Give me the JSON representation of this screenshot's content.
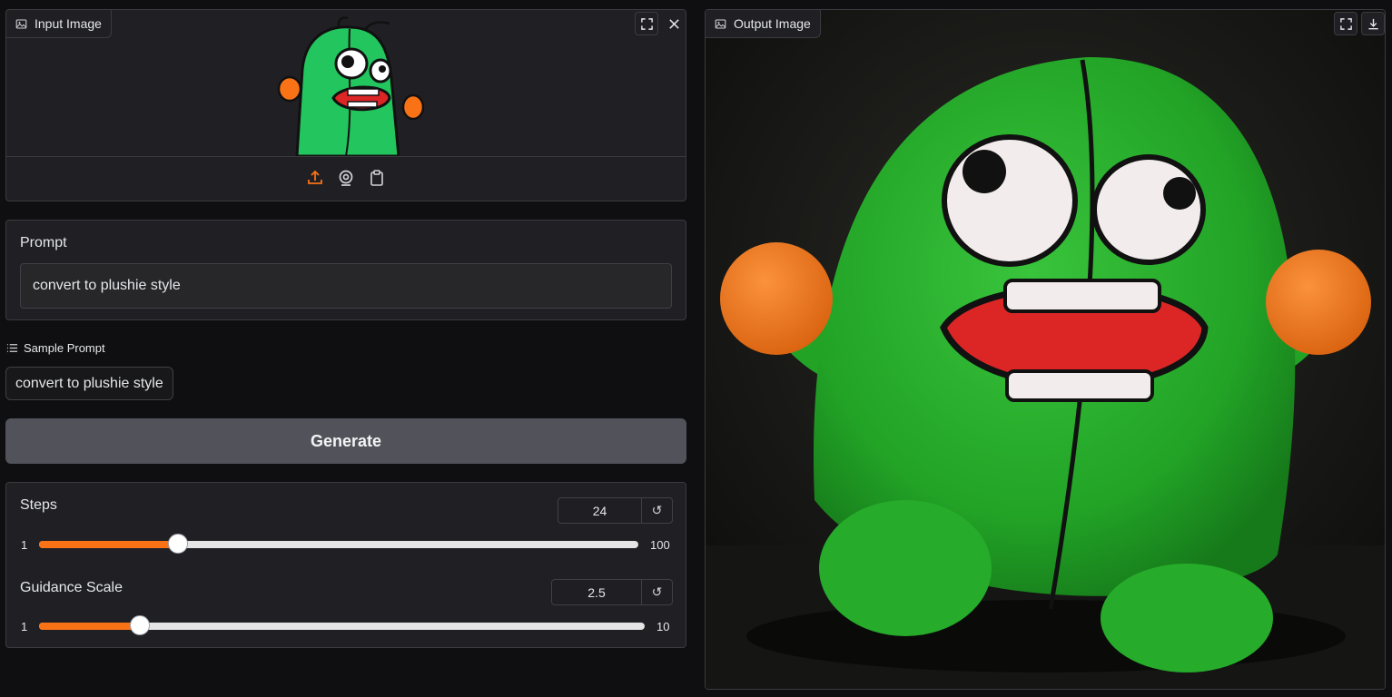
{
  "input_image": {
    "label": "Input Image",
    "toolbar": [
      "upload-icon",
      "webcam-icon",
      "clipboard-icon"
    ],
    "accent_color": "#f97316"
  },
  "prompt": {
    "label": "Prompt",
    "value": "convert to plushie style"
  },
  "examples": {
    "label": "Sample Prompt",
    "items": [
      "convert to plushie style"
    ]
  },
  "generate": {
    "label": "Generate",
    "color": "#52525b"
  },
  "steps": {
    "label": "Steps",
    "value": "24",
    "min": "1",
    "max": "100",
    "fraction": 0.2323
  },
  "guidance": {
    "label": "Guidance Scale",
    "value": "2.5",
    "min": "1",
    "max": "10",
    "fraction": 0.1667
  },
  "output_image": {
    "label": "Output Image",
    "buttons": [
      "fullscreen-icon",
      "download-icon"
    ]
  }
}
